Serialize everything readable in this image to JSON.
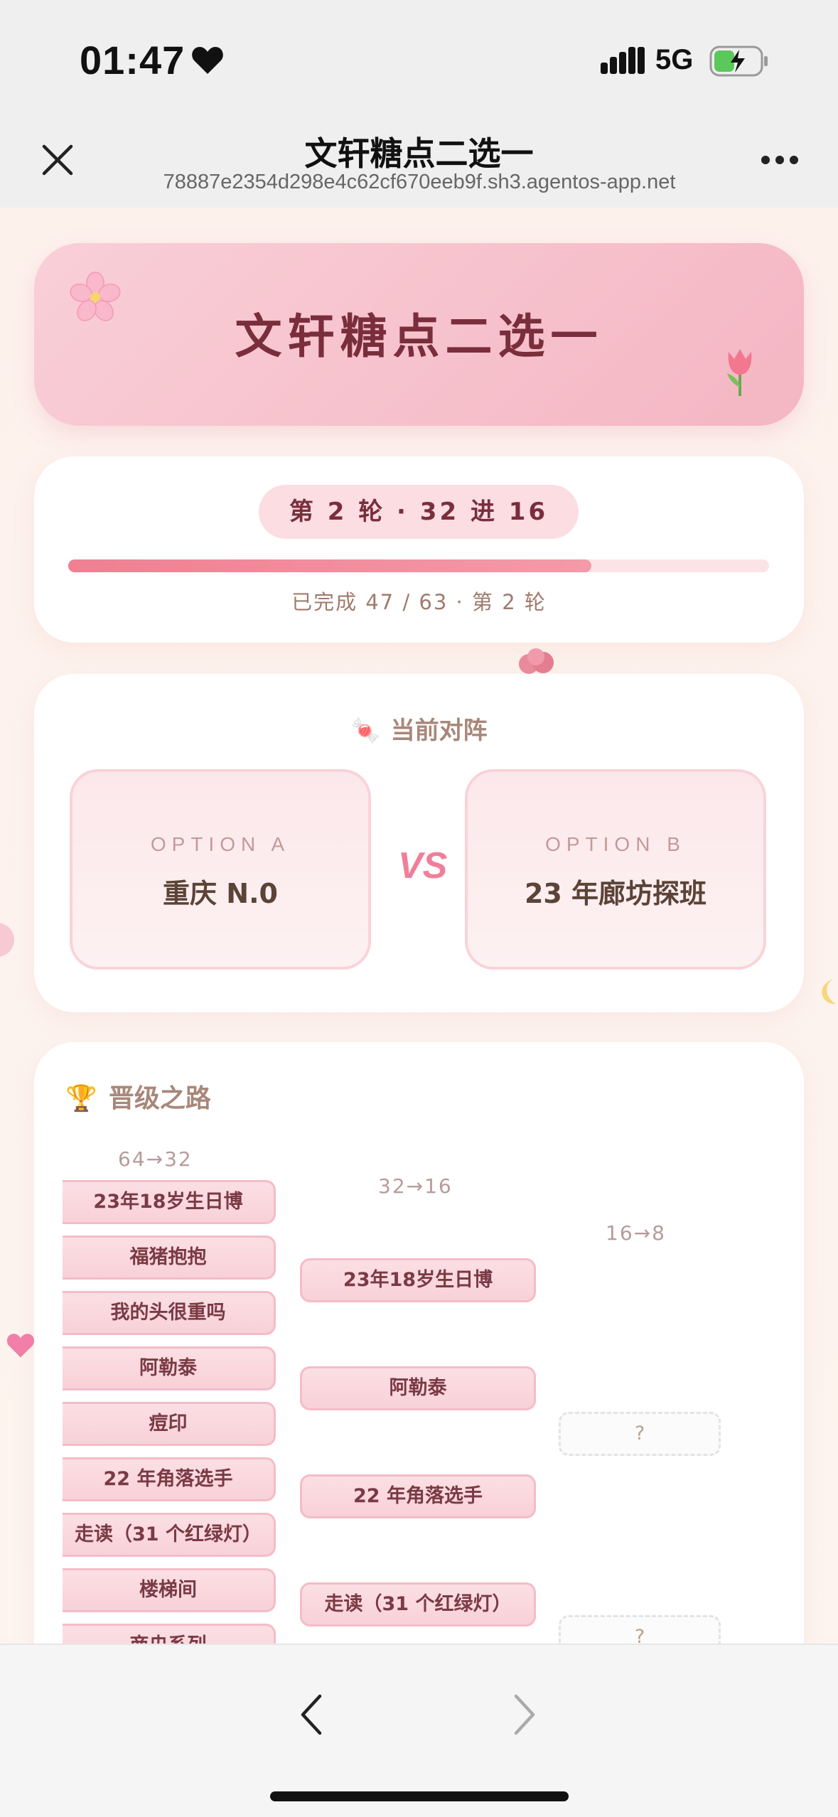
{
  "status_bar": {
    "time": "01:47",
    "network": "5G"
  },
  "nav": {
    "title": "文轩糖点二选一",
    "url": "78887e2354d298e4c62cf670eeb9f.sh3.agentos-app.net"
  },
  "hero": {
    "title": "文轩糖点二选一"
  },
  "round": {
    "pill": "第 2 轮 · 32 进 16",
    "progress_fraction": 0.746,
    "progress_text": "已完成 47 / 63 · 第 2 轮"
  },
  "match": {
    "title": "当前对阵",
    "option_a": {
      "label": "OPTION A",
      "name": "重庆 N.0"
    },
    "vs": "VS",
    "option_b": {
      "label": "OPTION B",
      "name": "23 年廊坊探班"
    }
  },
  "bracket": {
    "title": "晋级之路",
    "columns": [
      "64→32",
      "32→16",
      "16→8"
    ],
    "col1": [
      "23年18岁生日博",
      "福猪抱抱",
      "我的头很重吗",
      "阿勒泰",
      "痘印",
      "22 年角落选手",
      "走读（31 个红绿灯）",
      "楼梯间",
      "商央系列"
    ],
    "col2": [
      "23年18岁生日博",
      "阿勒泰",
      "22 年角落选手",
      "走读（31 个红绿灯）"
    ],
    "col3": [
      "?",
      "?"
    ]
  },
  "colors": {
    "accent": "#f07f92",
    "hero_text": "#7a2e3c",
    "muted": "#a8877a"
  }
}
